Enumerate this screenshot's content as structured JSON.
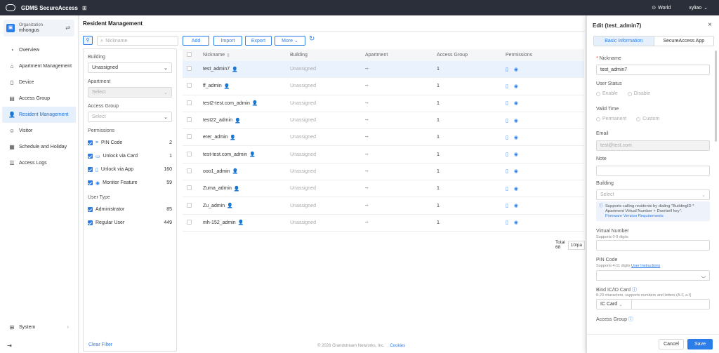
{
  "topbar": {
    "app_name": "GDMS SecureAccess",
    "region": "World",
    "user": "xyliao"
  },
  "sidebar": {
    "org_label": "Organization",
    "org_name": "mhongus",
    "items": [
      {
        "label": "Overview",
        "icon": "overview-icon"
      },
      {
        "label": "Apartment Management",
        "icon": "apartment-icon"
      },
      {
        "label": "Device",
        "icon": "device-icon"
      },
      {
        "label": "Access Group",
        "icon": "access-group-icon"
      },
      {
        "label": "Resident Management",
        "icon": "resident-icon",
        "active": true
      },
      {
        "label": "Visitor",
        "icon": "visitor-icon"
      },
      {
        "label": "Schedule and Holiday",
        "icon": "calendar-icon"
      },
      {
        "label": "Access Logs",
        "icon": "logs-icon"
      }
    ],
    "system_label": "System"
  },
  "page": {
    "title": "Resident Management"
  },
  "toolbar": {
    "search_placeholder": "Nickname",
    "add": "Add",
    "import": "Import",
    "export": "Export",
    "more": "More"
  },
  "filter": {
    "building_label": "Building",
    "building_value": "Unassigned",
    "apartment_label": "Apartment",
    "apartment_placeholder": "Select",
    "access_group_label": "Access Group",
    "access_group_placeholder": "Select",
    "permissions_label": "Permissions",
    "permissions": [
      {
        "label": "PIN Code",
        "count": "2"
      },
      {
        "label": "Unlock via Card",
        "count": "1"
      },
      {
        "label": "Unlock via App",
        "count": "160"
      },
      {
        "label": "Monitor Feature",
        "count": "59"
      }
    ],
    "user_type_label": "User Type",
    "user_types": [
      {
        "label": "Administrator",
        "count": "85"
      },
      {
        "label": "Regular User",
        "count": "449"
      }
    ],
    "clear": "Clear Filter"
  },
  "table": {
    "headers": [
      "Nickname",
      "Building",
      "Apartment",
      "Access Group",
      "Permissions"
    ],
    "rows": [
      {
        "nickname": "test_admin7",
        "building": "Unassigned",
        "apartment": "--",
        "access_group": "1"
      },
      {
        "nickname": "ff_admin",
        "building": "Unassigned",
        "apartment": "--",
        "access_group": "1"
      },
      {
        "nickname": "test2-test.com_admin",
        "building": "Unassigned",
        "apartment": "--",
        "access_group": "1"
      },
      {
        "nickname": "test22_admin",
        "building": "Unassigned",
        "apartment": "--",
        "access_group": "1"
      },
      {
        "nickname": "erer_admin",
        "building": "Unassigned",
        "apartment": "--",
        "access_group": "1"
      },
      {
        "nickname": "test-test.com_admin",
        "building": "Unassigned",
        "apartment": "--",
        "access_group": "1"
      },
      {
        "nickname": "ooo1_admin",
        "building": "Unassigned",
        "apartment": "--",
        "access_group": "1"
      },
      {
        "nickname": "Zuma_admin",
        "building": "Unassigned",
        "apartment": "--",
        "access_group": "1"
      },
      {
        "nickname": "Zu_admin",
        "building": "Unassigned",
        "apartment": "--",
        "access_group": "1"
      },
      {
        "nickname": "mh-152_admin",
        "building": "Unassigned",
        "apartment": "--",
        "access_group": "1"
      }
    ],
    "total": "Total 68",
    "page_size": "10/pa"
  },
  "footer": {
    "copyright": "© 2026 Grandstream Networks, Inc.",
    "cookies": "Cookies"
  },
  "drawer": {
    "title": "Edit (test_admin7)",
    "tab_basic": "Basic Information",
    "tab_app": "SecureAccess App",
    "nickname_label": "Nickname",
    "nickname_value": "test_admin7",
    "user_status_label": "User Status",
    "enable": "Enable",
    "disable": "Disable",
    "valid_time_label": "Valid Time",
    "permanent": "Permanent",
    "custom": "Custom",
    "email_label": "Email",
    "email_value": "test@test.com",
    "note_label": "Note",
    "building_label": "Building",
    "building_placeholder": "Select",
    "info_text": "Supports calling residents by dialing \"BuildingID * Apartment Virtual Number + Doorbell key\".",
    "info_link": "Firmware Version Requirements",
    "virtual_number_label": "Virtual Number",
    "virtual_number_hint": "Supports 0-9 digits",
    "pin_label": "PIN Code",
    "pin_hint": "Supports 4-11 digits",
    "pin_link": "User Instructions",
    "card_label": "Bind IC/ID Card",
    "card_hint": "8-20 characters, supports numbers and letters (A-F, a-f)",
    "card_type": "IC Card",
    "access_group_label": "Access Group",
    "cancel": "Cancel",
    "save": "Save"
  }
}
